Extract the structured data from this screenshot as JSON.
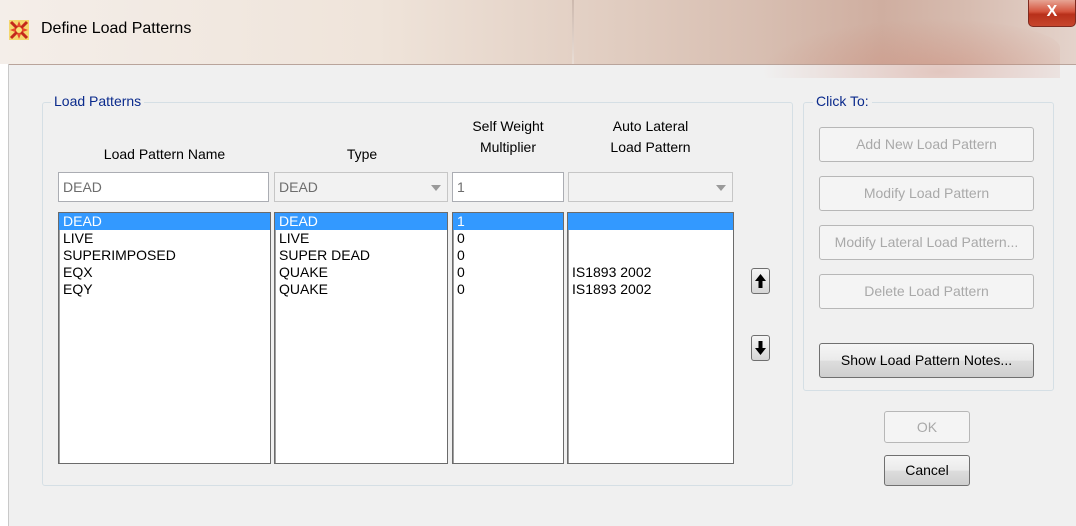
{
  "window": {
    "title": "Define Load Patterns",
    "close_label": "X",
    "icon": "app-star-icon"
  },
  "load_patterns": {
    "group_title": "Load Patterns",
    "headers": {
      "name": "Load Pattern Name",
      "type": "Type",
      "self_weight_line1": "Self Weight",
      "self_weight_line2": "Multiplier",
      "auto_lateral_line1": "Auto Lateral",
      "auto_lateral_line2": "Load Pattern"
    },
    "edit": {
      "name_value": "DEAD",
      "type_value": "DEAD",
      "multiplier_value": "1",
      "auto_lateral_value": ""
    },
    "rows": [
      {
        "name": "DEAD",
        "type": "DEAD",
        "multiplier": "1",
        "auto_lateral": "",
        "selected": true
      },
      {
        "name": "LIVE",
        "type": "LIVE",
        "multiplier": "0",
        "auto_lateral": "",
        "selected": false
      },
      {
        "name": "SUPERIMPOSED",
        "type": "SUPER DEAD",
        "multiplier": "0",
        "auto_lateral": "",
        "selected": false
      },
      {
        "name": "EQX",
        "type": "QUAKE",
        "multiplier": "0",
        "auto_lateral": "IS1893 2002",
        "selected": false
      },
      {
        "name": "EQY",
        "type": "QUAKE",
        "multiplier": "0",
        "auto_lateral": "IS1893 2002",
        "selected": false
      }
    ],
    "move_up_icon": "arrow-up-icon",
    "move_down_icon": "arrow-down-icon"
  },
  "click_to": {
    "group_title": "Click To:",
    "add_label": "Add New Load Pattern",
    "modify_label": "Modify Load Pattern",
    "modify_lateral_label": "Modify Lateral Load Pattern...",
    "delete_label": "Delete Load Pattern",
    "show_notes_label": "Show Load Pattern Notes..."
  },
  "footer": {
    "ok_label": "OK",
    "cancel_label": "Cancel"
  },
  "colors": {
    "selection": "#3399ff",
    "group_title": "#0a2a8c",
    "close_button": "#c7462d"
  }
}
